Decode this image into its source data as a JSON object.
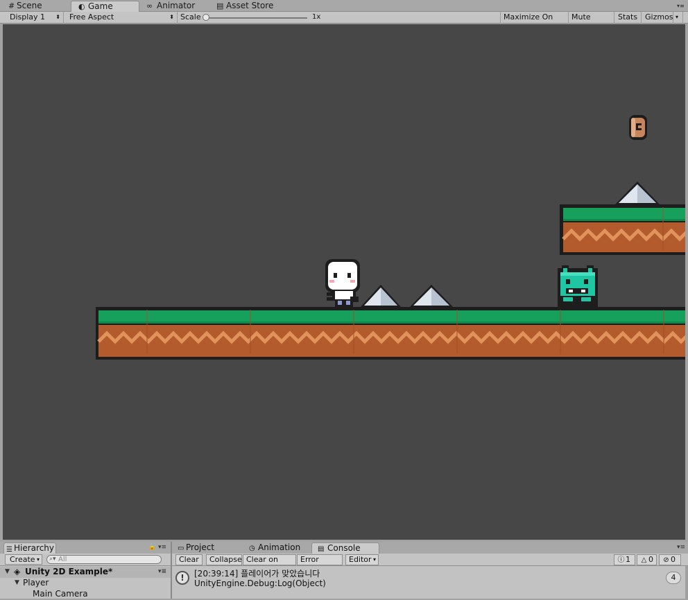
{
  "editor_tabs": [
    {
      "label": "Scene",
      "icon": "grid-icon"
    },
    {
      "label": "Game",
      "icon": "game-icon"
    },
    {
      "label": "Animator",
      "icon": "animator-icon"
    },
    {
      "label": "Asset Store",
      "icon": "store-icon"
    }
  ],
  "game_toolbar": {
    "display": "Display 1",
    "aspect": "Free Aspect",
    "scale_label": "Scale",
    "scale_value": "1x",
    "maximize": "Maximize On Play",
    "mute": "Mute Audio",
    "stats": "Stats",
    "gizmos": "Gizmos"
  },
  "game_colors": {
    "background": "#474747",
    "grass": "#16a05c",
    "dirt": "#b45b2d",
    "enemy": "#1ec6a4"
  },
  "hierarchy": {
    "tab_label": "Hierarchy",
    "create_label": "Create",
    "search_placeholder": "All",
    "scene_name": "Unity 2D Example*",
    "items": [
      {
        "label": "Player",
        "expanded": true
      },
      {
        "label": "Main Camera"
      }
    ]
  },
  "bottom_tabs": [
    {
      "label": "Project",
      "icon": "folder-icon"
    },
    {
      "label": "Animation",
      "icon": "clock-icon"
    },
    {
      "label": "Console",
      "icon": "console-icon"
    }
  ],
  "console": {
    "buttons": [
      "Clear",
      "Collapse",
      "Clear on Play",
      "Error Pause",
      "Editor"
    ],
    "counts": {
      "log": "1",
      "warning": "0",
      "error": "0"
    },
    "entry": {
      "line1": "[20:39:14] 플레이어가 맞았습니다",
      "line2": "UnityEngine.Debug:Log(Object)",
      "count": "4"
    }
  }
}
